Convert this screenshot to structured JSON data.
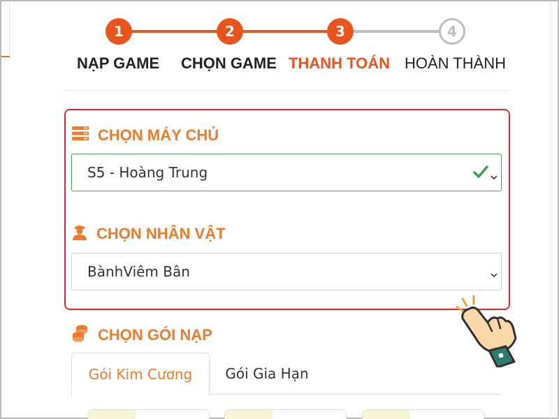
{
  "stepper": {
    "steps": [
      {
        "number": "1",
        "label": "NẠP GAME",
        "state": "done"
      },
      {
        "number": "2",
        "label": "CHỌN GAME",
        "state": "done"
      },
      {
        "number": "3",
        "label": "THANH TOÁN",
        "state": "current"
      },
      {
        "number": "4",
        "label": "HOÀN THÀNH",
        "state": "pending"
      }
    ]
  },
  "server_section": {
    "title": "CHỌN MÁY CHỦ",
    "icon": "server-icon",
    "selected_value": "S5 - Hoàng Trung",
    "validated": true
  },
  "character_section": {
    "title": "CHỌN NHÂN VẬT",
    "icon": "user-icon",
    "selected_value": "BànhViêm Bân"
  },
  "package_section": {
    "title": "CHỌN GÓI NẠP",
    "icon": "coins-icon",
    "tabs": [
      {
        "label": "Gói Kim Cương",
        "active": true
      },
      {
        "label": "Gói Gia Hạn",
        "active": false
      }
    ]
  },
  "colors": {
    "accent": "#e8541d",
    "section_title": "#ec7b2c",
    "highlight_border": "#d9262c",
    "valid": "#3ea049",
    "inactive": "#bdbdbd"
  }
}
